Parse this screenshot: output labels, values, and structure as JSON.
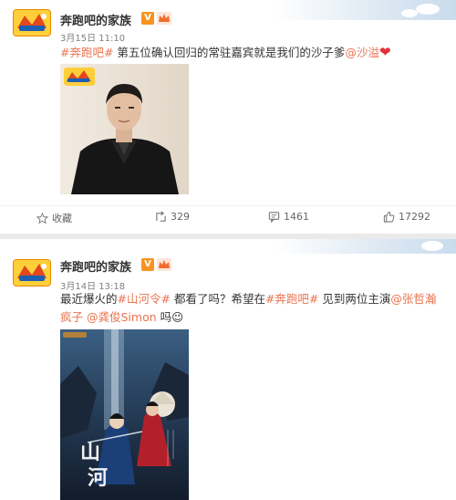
{
  "posts": [
    {
      "author": "奔跑吧的家族",
      "badge": "V",
      "time": "3月15日 11:10",
      "text": {
        "tag": "#奔跑吧#",
        "body": " 第五位确认回归的常驻嘉宾就是我们的沙子爹",
        "mention": "@沙溢",
        "emoji": "❤"
      },
      "actions": {
        "favorite": "收藏",
        "repost": "329",
        "comment": "1461",
        "like": "17292"
      }
    },
    {
      "author": "奔跑吧的家族",
      "badge": "V",
      "time": "3月14日 13:18",
      "text": {
        "part1": "最近爆火的",
        "tag1": "#山河令#",
        "part2": " 都看了吗？希望在",
        "tag2": "#奔跑吧#",
        "part3": " 见到两位主演",
        "mention1": "@张哲瀚疯子",
        "mention2": "@龚俊Simon",
        "part4": " 吗",
        "emoji": "😉"
      },
      "poster_title": "山河"
    }
  ],
  "colors": {
    "accent": "#eb7350",
    "badge": "#f7931e",
    "heart": "#e0323a",
    "muted": "#808080"
  },
  "icons": {
    "favorite": "star-icon",
    "repost": "repost-icon",
    "comment": "comment-icon",
    "like": "thumbs-up-icon"
  }
}
